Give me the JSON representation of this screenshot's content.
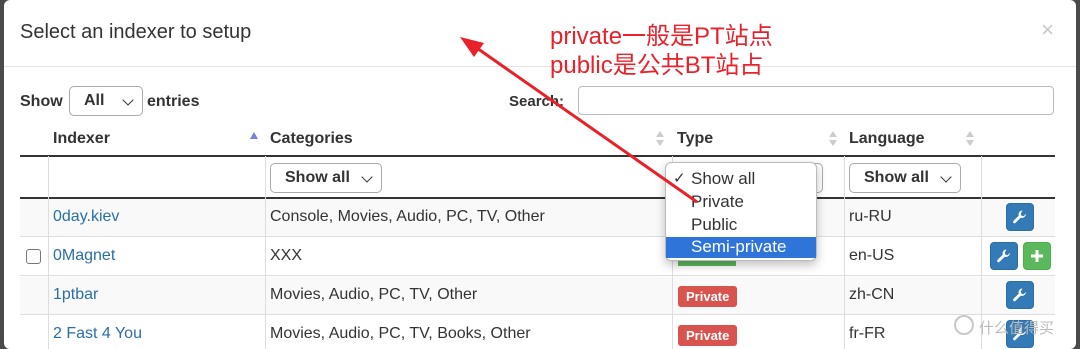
{
  "modal": {
    "title": "Select an indexer to setup",
    "close_label": "×"
  },
  "controls": {
    "show_label": "Show",
    "show_value": "All",
    "entries_label": "entries",
    "search_label": "Search:",
    "search_value": ""
  },
  "table": {
    "headers": [
      "Indexer",
      "Categories",
      "Type",
      "Language"
    ],
    "filters": {
      "categories": "Show all",
      "type": "Show all",
      "language": "Show all"
    },
    "rows": [
      {
        "name": "0day.kiev",
        "categories": "Console, Movies, Audio, PC, TV, Other",
        "type": "",
        "language": "ru-RU"
      },
      {
        "name": "0Magnet",
        "categories": "XXX",
        "type": "",
        "language": "en-US"
      },
      {
        "name": "1ptbar",
        "categories": "Movies, Audio, PC, TV, Other",
        "type": "Private",
        "language": "zh-CN"
      },
      {
        "name": "2 Fast 4 You",
        "categories": "Movies, Audio, PC, TV, Books, Other",
        "type": "Private",
        "language": "fr-FR"
      }
    ]
  },
  "type_dropdown": {
    "options": [
      "Show all",
      "Private",
      "Public",
      "Semi-private"
    ],
    "checked": "Show all",
    "highlighted": "Semi-private"
  },
  "annotation": {
    "line1": "private一般是PT站点",
    "line2": "public是公共BT站占",
    "color": "#e8212b"
  },
  "watermark": {
    "text": "什么值得买"
  },
  "colors": {
    "link": "#2a6ea8",
    "private_badge": "#d9534f",
    "public_badge": "#5cb85c",
    "button_blue": "#337ab7",
    "button_green": "#5cb85c",
    "dropdown_highlight": "#2f74d8"
  },
  "icons": {
    "config_button": "wrench-icon",
    "add_button": "plus-icon",
    "sort_indicator": "sort-arrows-icon"
  }
}
